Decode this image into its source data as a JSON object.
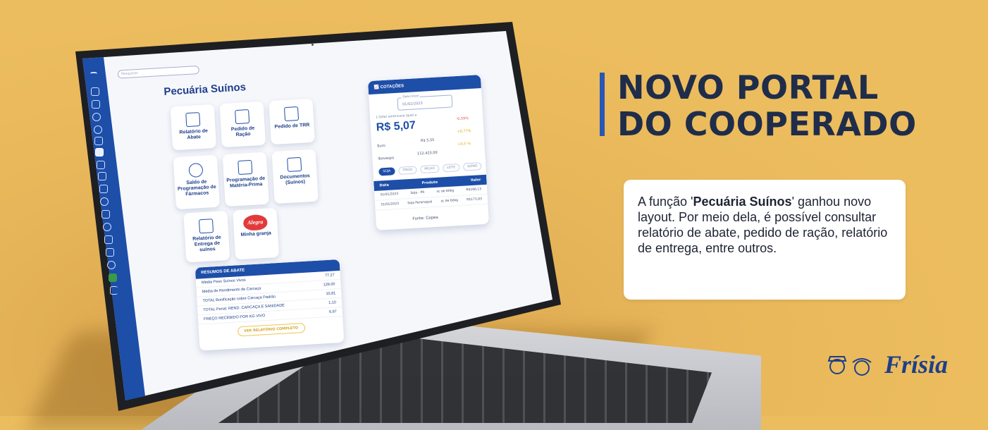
{
  "portal": {
    "search_placeholder": "Pesquisar",
    "page_title": "Pecuária Suínos",
    "tiles": [
      {
        "label": "Relatório de Abate"
      },
      {
        "label": "Pedido de Ração"
      },
      {
        "label": "Pedido de TRR"
      },
      {
        "label": "Saldo de Programação de Fármacos"
      },
      {
        "label": "Programação de Matéria-Prima"
      },
      {
        "label": "Documentos (Suínos)"
      },
      {
        "label": "Relatório de Entrega de suínos"
      },
      {
        "label": "Minha granja",
        "brand": "Alegra"
      }
    ],
    "abate": {
      "title": "RESUMOS DE ABATE",
      "rows": [
        {
          "label": "Média Peso Suínos Vivos",
          "value": "77,27"
        },
        {
          "label": "Média de Rendimento de Carcaça",
          "value": "129,00"
        },
        {
          "label": "TOTAL Bonificação sobre Carcaça Padrão",
          "value": "10,81"
        },
        {
          "label": "TOTAL Penal. REND. CARCAÇA E SANIDADE",
          "value": "1,10"
        },
        {
          "label": "PREÇO RECEBIDO POR KG VIVO",
          "value": "6,97"
        }
      ],
      "button": "VER RELATÓRIO COMPLETO"
    },
    "cotacoes": {
      "title": "COTAÇÕES",
      "date_label": "Data inicial",
      "date_value": "01/02/2023",
      "dollar_label": "1 Dólar americano igual a",
      "dollar_value": "R$ 5,07",
      "dollar_var": "-0,59%",
      "euro_label": "Euro",
      "euro_value": "R$ 5,55",
      "euro_var": "+0,77%",
      "ibov_label": "Ibovespa",
      "ibov_value": "112.423,00",
      "ibov_var": "+0,5 %",
      "pills": [
        "SOJA",
        "TRIGO",
        "MILHO",
        "LEITE",
        "SUÍNO"
      ],
      "table_headers": [
        "Data",
        "Produto",
        "Valor"
      ],
      "table_rows": [
        {
          "date": "31/01/2023",
          "product": "Soja - PR",
          "unit": "sc de 60kg",
          "value": "R$166,13"
        },
        {
          "date": "31/01/2023",
          "product": "Soja Paranaguá",
          "unit": "sc de 60kg",
          "value": "R$173,93"
        }
      ],
      "source": "Fonte: Cepea"
    }
  },
  "headline": {
    "line1": "NOVO PORTAL",
    "line2": "DO COOPERADO"
  },
  "card": {
    "prefix": "A função '",
    "highlight": "Pecuária Suínos",
    "suffix": "' ganhou novo layout. Por meio dela, é possível consultar relatório de abate, pedido de ração, relatório de entrega, entre outros."
  },
  "brand": {
    "name": "Frísia"
  },
  "colors": {
    "background": "#ecbd5e",
    "portal_blue": "#1d4ea8",
    "headline": "#1f2d4a"
  }
}
